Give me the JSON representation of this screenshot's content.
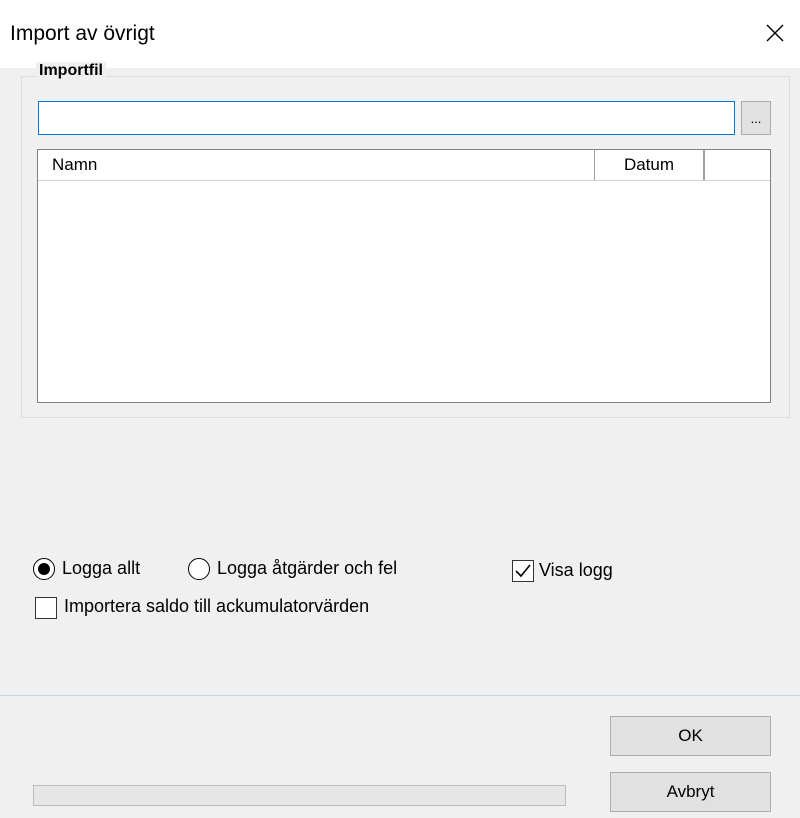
{
  "window": {
    "title": "Import av övrigt",
    "close_icon": "close-icon"
  },
  "import_group": {
    "label": "Importfil",
    "file_path": {
      "value": "",
      "placeholder": ""
    },
    "browse_label": "...",
    "list": {
      "columns": [
        "Namn",
        "Datum",
        ""
      ],
      "rows": []
    }
  },
  "options": {
    "log_all_label": "Logga allt",
    "log_all_checked": true,
    "log_actions_label": "Logga åtgärder och fel",
    "log_actions_checked": false,
    "show_log_label": "Visa logg",
    "show_log_checked": true,
    "import_balance_label": "Importera saldo till ackumulatorvärden",
    "import_balance_checked": false
  },
  "buttons": {
    "ok_label": "OK",
    "cancel_label": "Avbryt"
  },
  "progress": {
    "value": 0
  },
  "colors": {
    "focus_border": "#0078d7",
    "dialog_bg": "#f0f0f0",
    "button_bg": "#e1e1e1"
  }
}
